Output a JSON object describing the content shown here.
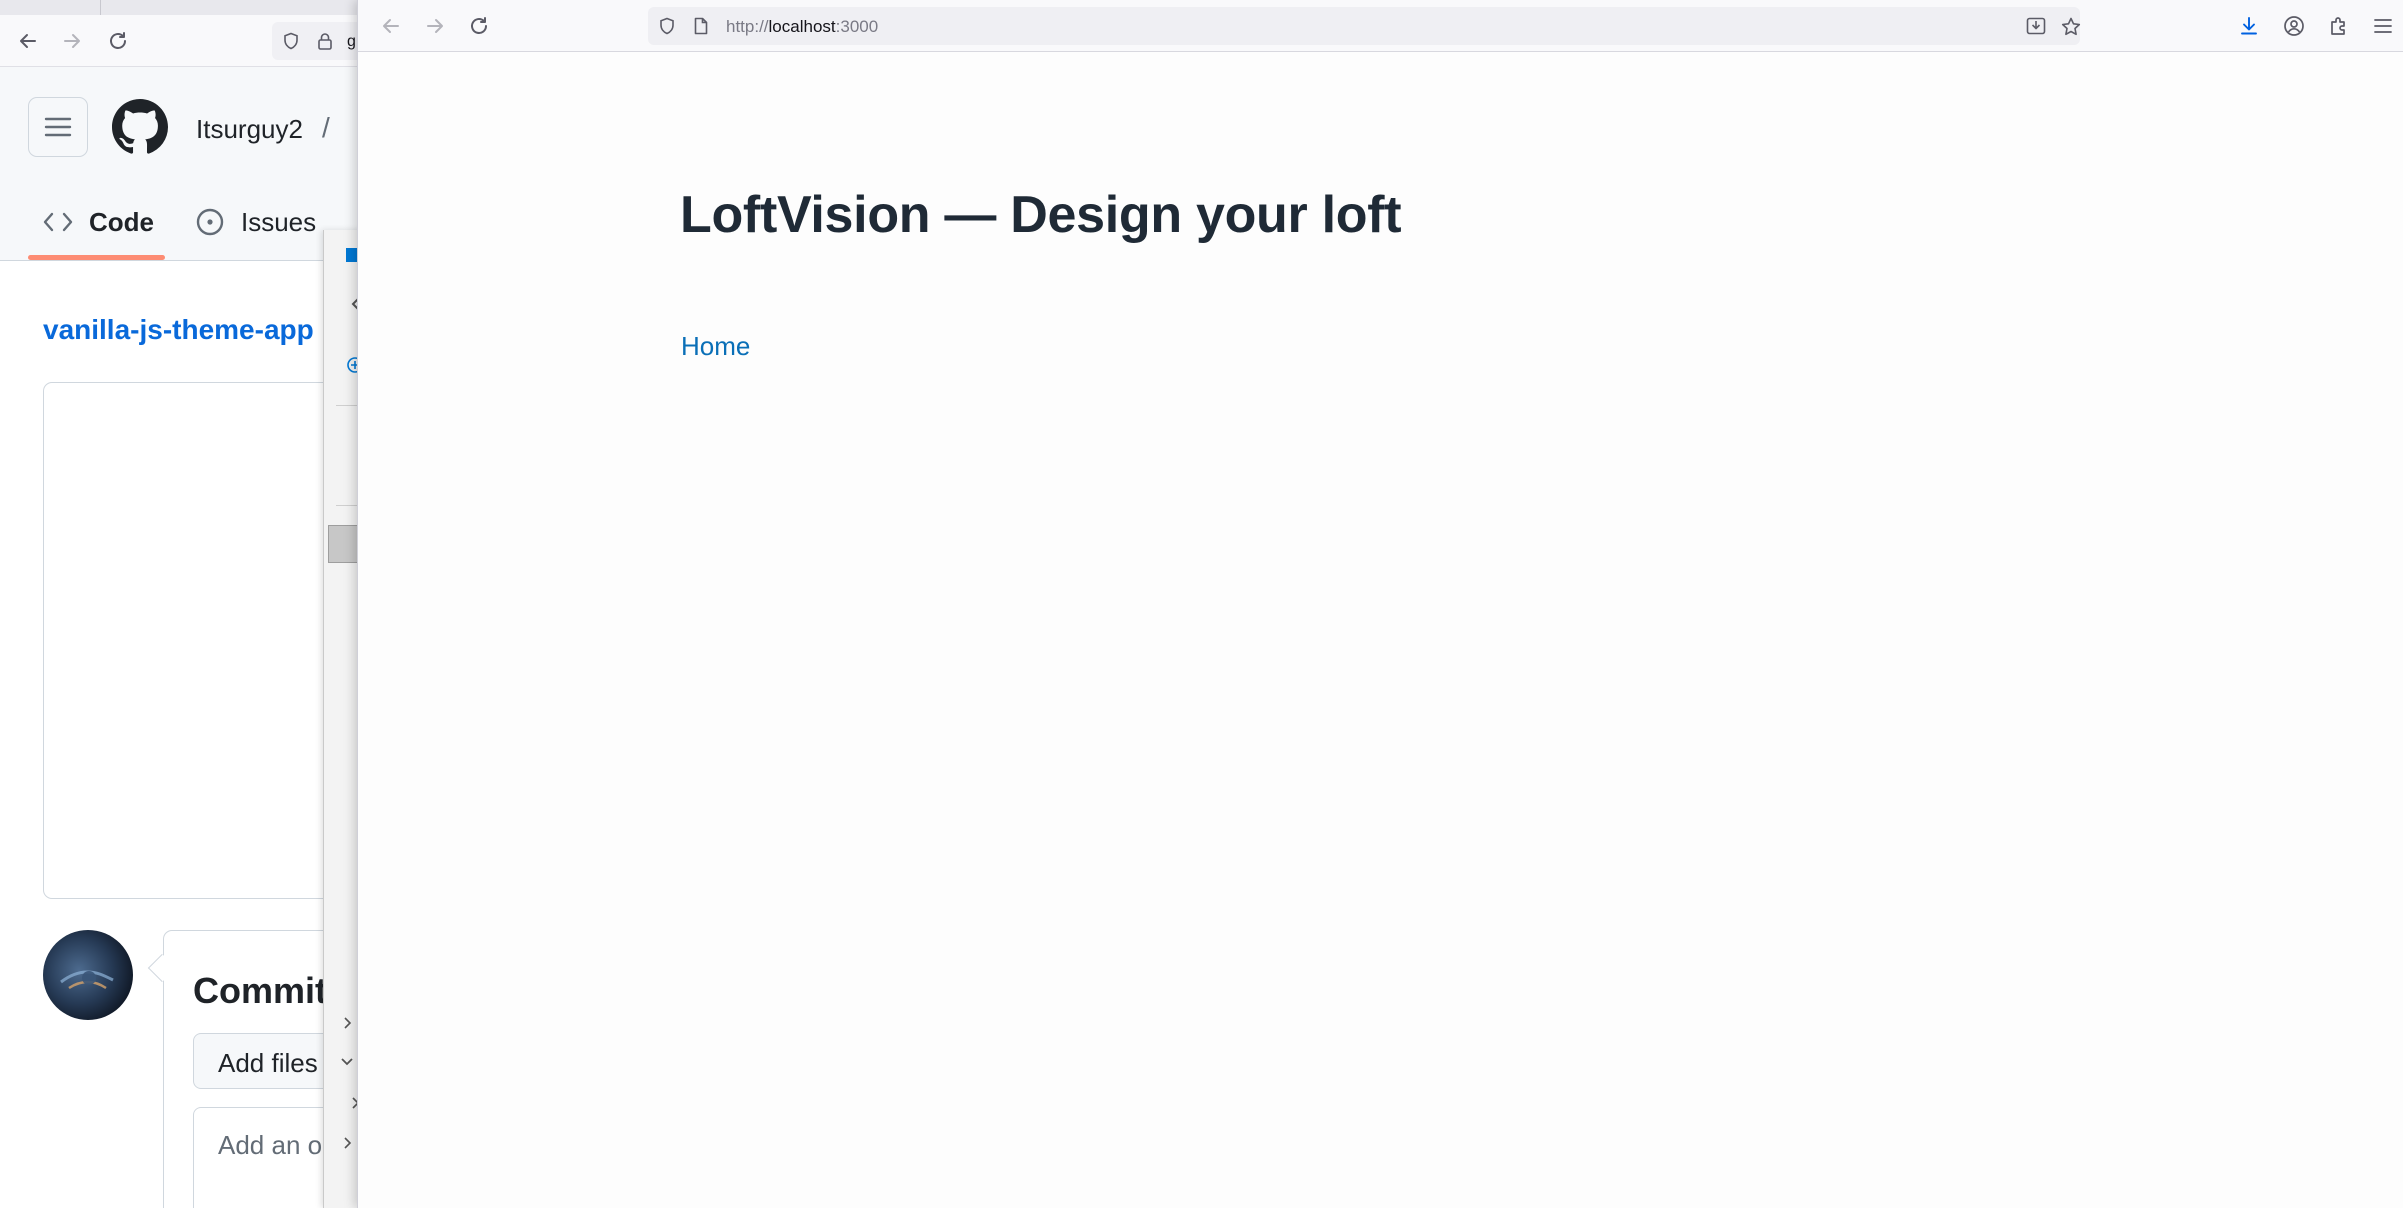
{
  "background_window": {
    "url_partial": "g",
    "github": {
      "owner": "Itsurguy2",
      "separator": "/",
      "tabs": [
        {
          "label": "Code",
          "icon": "code-icon"
        },
        {
          "label": "Issues",
          "icon": "issue-opened-icon"
        }
      ],
      "repo_link": "vanilla-js-theme-app",
      "commit": {
        "title": "Commit",
        "add_files": "Add files",
        "add_placeholder": "Add an o"
      },
      "colors": {
        "link": "#0969da",
        "tab_underline": "#fd8c73"
      }
    }
  },
  "front_window": {
    "address_bar": {
      "scheme": "http://",
      "host": "localhost",
      "port": ":3000"
    },
    "page": {
      "title": "LoftVision — Design your loft",
      "nav_link": "Home"
    },
    "colors": {
      "title": "#1f2a36",
      "link": "#0a6fb7",
      "download_icon": "#0061e0"
    }
  }
}
